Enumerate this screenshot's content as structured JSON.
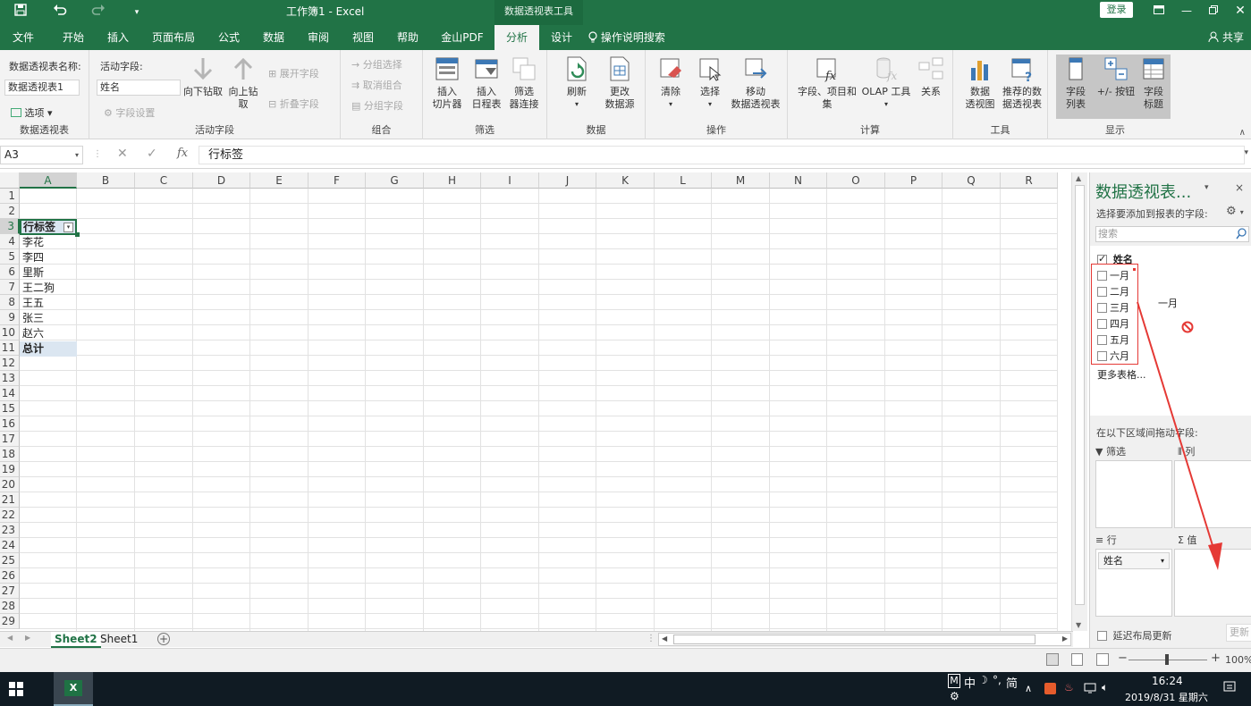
{
  "titlebar": {
    "doc_title": "工作簿1  -  Excel",
    "context_tab_title": "数据透视表工具",
    "login": "登录"
  },
  "tabs": [
    "文件",
    "开始",
    "插入",
    "页面布局",
    "公式",
    "数据",
    "审阅",
    "视图",
    "帮助",
    "金山PDF",
    "分析",
    "设计"
  ],
  "active_tab": "分析",
  "tell_me": "操作说明搜索",
  "share": "共享",
  "ribbon": {
    "pivot_name_label": "数据透视表名称:",
    "pivot_name_value": "数据透视表1",
    "options_label": "选项",
    "group_pivot": "数据透视表",
    "active_field_label": "活动字段:",
    "active_field_value": "姓名",
    "field_settings": "字段设置",
    "drill_down": "向下钻取",
    "drill_up_1": "向上钻",
    "drill_up_2": "取",
    "expand_field": "展开字段",
    "collapse_field": "折叠字段",
    "group_active_field": "活动字段",
    "group_selection": "分组选择",
    "ungroup": "取消组合",
    "group_field": "分组字段",
    "group_group": "组合",
    "insert_slicer_1": "插入",
    "insert_slicer_2": "切片器",
    "insert_timeline_1": "插入",
    "insert_timeline_2": "日程表",
    "filter_conn_1": "筛选",
    "filter_conn_2": "器连接",
    "group_filter": "筛选",
    "refresh": "刷新",
    "change_source_1": "更改",
    "change_source_2": "数据源",
    "group_data": "数据",
    "clear": "清除",
    "select": "选择",
    "move_1": "移动",
    "move_2": "数据透视表",
    "group_actions": "操作",
    "fields_items_1": "字段、项目和",
    "fields_items_2": "集",
    "olap_tools": "OLAP 工具",
    "relationships": "关系",
    "group_calc": "计算",
    "pivot_chart_1": "数据",
    "pivot_chart_2": "透视图",
    "recommended_1": "推荐的数",
    "recommended_2": "据透视表",
    "group_tools": "工具",
    "field_list_1": "字段",
    "field_list_2": "列表",
    "plus_minus": "+/- 按钮",
    "field_headers_1": "字段",
    "field_headers_2": "标题",
    "group_show": "显示"
  },
  "formula_bar": {
    "name_box": "A3",
    "fx": "fx",
    "formula": "行标签"
  },
  "sheet": {
    "columns": [
      "A",
      "B",
      "C",
      "D",
      "E",
      "F",
      "G",
      "H",
      "I",
      "J",
      "K",
      "L",
      "M",
      "N",
      "O",
      "P",
      "Q",
      "R"
    ],
    "rows": [
      "1",
      "2",
      "3",
      "4",
      "5",
      "6",
      "7",
      "8",
      "9",
      "10",
      "11",
      "12",
      "13",
      "14",
      "15",
      "16",
      "17",
      "18",
      "19",
      "20",
      "21",
      "22",
      "23",
      "24",
      "25",
      "26",
      "27",
      "28",
      "29"
    ],
    "cells": {
      "a3": "行标签",
      "a4": "李花",
      "a5": "李四",
      "a6": "里斯",
      "a7": "王二狗",
      "a8": "王五",
      "a9": "张三",
      "a10": "赵六",
      "a11": "总计"
    },
    "tabs": [
      "Sheet2",
      "Sheet1"
    ],
    "active_tab": "Sheet2"
  },
  "pane": {
    "title": "数据透视表...",
    "subtitle": "选择要添加到报表的字段:",
    "search_placeholder": "搜索",
    "fields": [
      {
        "label": "姓名",
        "checked": true
      },
      {
        "label": "一月",
        "checked": false
      },
      {
        "label": "二月",
        "checked": false
      },
      {
        "label": "三月",
        "checked": false
      },
      {
        "label": "四月",
        "checked": false
      },
      {
        "label": "五月",
        "checked": false
      },
      {
        "label": "六月",
        "checked": false
      }
    ],
    "more_tables": "更多表格...",
    "drag_label": "一月",
    "areas_label": "在以下区域间拖动字段:",
    "filters": "筛选",
    "columns": "列",
    "rows": "行",
    "values": "值",
    "row_item": "姓名",
    "defer_update": "延迟布局更新",
    "update_btn": "更新"
  },
  "status": {
    "zoom": "100%"
  },
  "taskbar": {
    "ime": "中",
    "ime_extra": "简",
    "time": "16:24",
    "date": "2019/8/31 星期六"
  },
  "colors": {
    "excel_green": "#217346",
    "annotation_red": "#e53935"
  }
}
